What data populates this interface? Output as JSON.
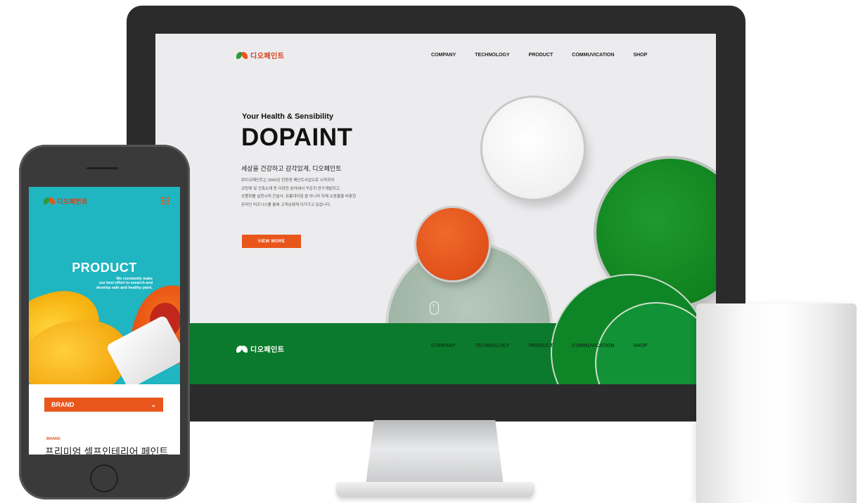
{
  "desktop": {
    "logo_text": "디오페인트",
    "nav": [
      "COMPANY",
      "TECHNOLOGY",
      "PRODUCT",
      "COMMUVICATION",
      "SHOP"
    ],
    "subtitle": "Your Health & Sensibility",
    "title": "DOPAINT",
    "korean_heading": "세상을 건강하고 감각있게, 디오페인트",
    "body_lines": [
      "㈜디오페인트는 2000년 친환경 페인트사업으로 시작하여",
      "코팅제 및 건축소재 등 다양한 분야에서 꾸준히 연구개발하고,",
      "상품화를 실현시켜 건설사, 유통대리점 뿐 아니라 자체 쇼핑몰을 비롯한",
      "온라인 비즈니스를 통해 고객님에게 다가가고 있습니다."
    ],
    "button": "VIEW MORE",
    "footer_logo_text": "디오페인트",
    "footer_nav": [
      "COMPANY",
      "TECHNOLOGY",
      "PRODUCT",
      "COMMUVICATION",
      "SHOP"
    ]
  },
  "mobile": {
    "logo_text": "디오페인트",
    "hero_title": "PRODUCT",
    "hero_desc": [
      "We constantly make",
      "our best effort to esearch and",
      "develop safe and healthy paint."
    ],
    "brand_bar": "BRAND",
    "brand_small": "BRAND",
    "product_title": "프리미엄 셀프인테리어 페인트"
  },
  "colors": {
    "accent_orange": "#e8561c",
    "footer_green": "#0c7a2c",
    "hero_teal": "#1fb5c1"
  }
}
